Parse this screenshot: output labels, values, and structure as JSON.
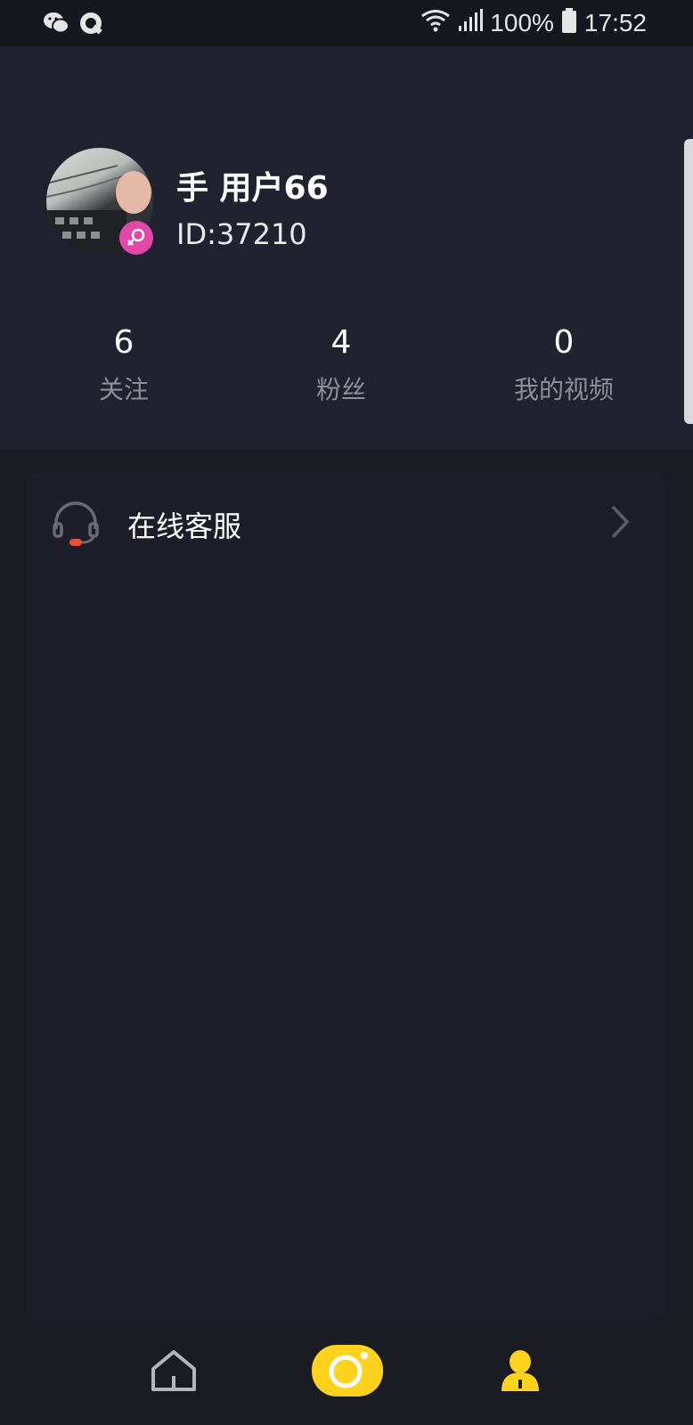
{
  "status_bar": {
    "battery_percent": "100%",
    "time": "17:52",
    "left_icons": [
      "wechat-icon",
      "qq-icon"
    ],
    "right_icons": [
      "wifi-icon",
      "signal-icon",
      "battery-icon"
    ]
  },
  "profile": {
    "name": "手 用户66",
    "id_text": "ID:37210",
    "gender_icon": "female-icon",
    "stats": [
      {
        "value": "6",
        "label": "关注"
      },
      {
        "value": "4",
        "label": "粉丝"
      },
      {
        "value": "0",
        "label": "我的视频"
      }
    ]
  },
  "menu": {
    "items": [
      {
        "label": "在线客服",
        "icon": "headset-icon"
      }
    ]
  },
  "bottom_nav": {
    "items": [
      {
        "icon": "home-icon"
      },
      {
        "icon": "camera-icon"
      },
      {
        "icon": "profile-icon",
        "active": true
      }
    ]
  },
  "colors": {
    "accent": "#ffd21e",
    "gender_badge": "#e148a8",
    "header_bg": "#212230",
    "page_bg": "#1a1b23"
  }
}
